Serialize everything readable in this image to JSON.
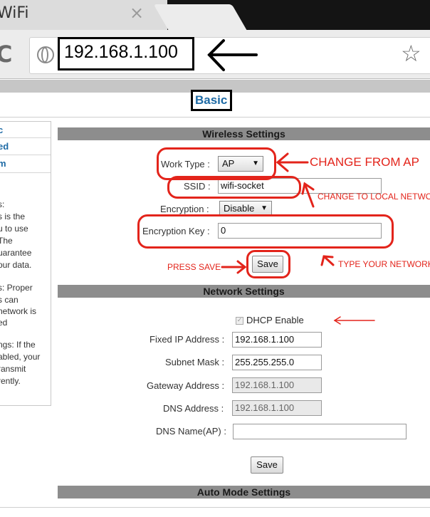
{
  "browser": {
    "tab_title": "WiFi",
    "tab_close": "×",
    "url": "192.168.1.100"
  },
  "page": {
    "title": "Basic",
    "sidebar": {
      "links": [
        "c",
        "ed",
        "m"
      ],
      "notes": [
        "s:",
        "s is the",
        "u to use",
        "The",
        "uarantee",
        "our data.",
        "s: Proper",
        "s can",
        "network is",
        "ed",
        "ngs: If the",
        "abled, your",
        "ransmit",
        "rently."
      ]
    },
    "wireless": {
      "title": "Wireless Settings",
      "work_type_label": "Work Type :",
      "work_type_value": "AP",
      "ssid_label": "SSID :",
      "ssid_value": "wifi-socket",
      "encryption_label": "Encryption :",
      "encryption_value": "Disable",
      "key_label": "Encryption Key :",
      "key_value": "0",
      "save_label": "Save"
    },
    "network": {
      "title": "Network Settings",
      "dhcp_label": "DHCP Enable",
      "fixed_ip_label": "Fixed IP Address :",
      "fixed_ip_value": "192.168.1.100",
      "subnet_label": "Subnet Mask :",
      "subnet_value": "255.255.255.0",
      "gateway_label": "Gateway Address :",
      "gateway_value": "192.168.1.100",
      "dns_label": "DNS Address :",
      "dns_value": "192.168.1.100",
      "dns_name_label": "DNS Name(AP) :",
      "dns_name_value": "",
      "save_label": "Save"
    },
    "auto_mode": {
      "title": "Auto Mode Settings"
    }
  },
  "annotations": {
    "change_from_ap": "CHANGE FROM AP",
    "change_to_local": "CHANGE TO LOCAL NETWO",
    "press_save": "PRESS SAVE",
    "type_network": "TYPE YOUR NETWORK"
  },
  "colors": {
    "annotation_red": "#e3241b",
    "link_blue": "#1d6aa5",
    "section_gray": "#8d8d8d"
  }
}
